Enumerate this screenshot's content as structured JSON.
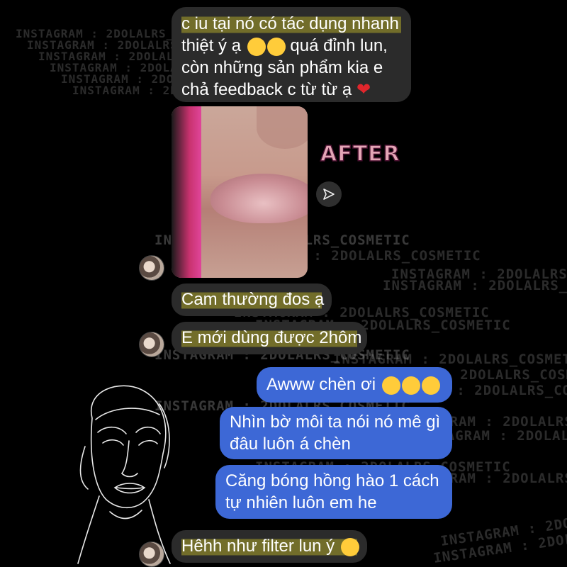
{
  "watermark_text": "INSTAGRAM : 2DOLALRS_COSMETIC",
  "messages": {
    "m1": {
      "line1": "c iu tại nó có tác dụng nhanh",
      "line2": "thiệt ý ạ",
      "line2b": "quá đỉnh lun,",
      "line3": "còn những sản phẩm kia e",
      "line4": "chả feedback c từ từ ạ"
    },
    "photo_label": "AFTER",
    "m2": "Cam thường đos ạ",
    "m3": "E mới dùng được 2hôm",
    "m4": "Awww chèn ơi",
    "m5": {
      "line1": "Nhìn bờ môi ta nói nó mê gì",
      "line2": "đâu luôn á chèn"
    },
    "m6": {
      "line1": "Căng bóng hồng hào 1 cách",
      "line2": "tự nhiên luôn em he"
    },
    "m7": "Hêhh như filter lun ý"
  },
  "icons": {
    "heart_eyes": "heart-eyes-emoji",
    "star_struck": "star-struck-emoji",
    "tongue": "squinting-tongue-emoji",
    "heart": "red-heart-emoji",
    "share": "send-icon"
  },
  "colors": {
    "background": "#000000",
    "incoming_bubble": "#2b2b2b",
    "outgoing_bubble": "#3d68d6",
    "highlight": "#c8be28"
  }
}
